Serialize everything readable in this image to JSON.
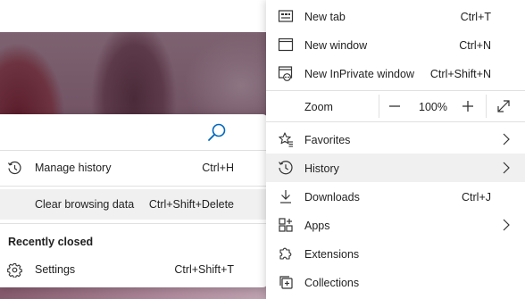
{
  "history_flyout": {
    "items": [
      {
        "label": "Manage history",
        "shortcut": "Ctrl+H"
      },
      {
        "label": "Clear browsing data",
        "shortcut": "Ctrl+Shift+Delete"
      }
    ],
    "section_title": "Recently closed",
    "recent": [
      {
        "label": "Settings",
        "shortcut": "Ctrl+Shift+T"
      }
    ]
  },
  "menu": {
    "new_tab": {
      "label": "New tab",
      "shortcut": "Ctrl+T"
    },
    "new_window": {
      "label": "New window",
      "shortcut": "Ctrl+N"
    },
    "new_inprivate": {
      "label": "New InPrivate window",
      "shortcut": "Ctrl+Shift+N"
    },
    "zoom": {
      "label": "Zoom",
      "minus": "—",
      "value": "100%",
      "plus": "+"
    },
    "favorites": {
      "label": "Favorites"
    },
    "history": {
      "label": "History"
    },
    "downloads": {
      "label": "Downloads",
      "shortcut": "Ctrl+J"
    },
    "apps": {
      "label": "Apps"
    },
    "extensions": {
      "label": "Extensions"
    },
    "collections": {
      "label": "Collections"
    }
  },
  "colors": {
    "accent": "#0067c0",
    "hover": "#f0f0f0"
  }
}
